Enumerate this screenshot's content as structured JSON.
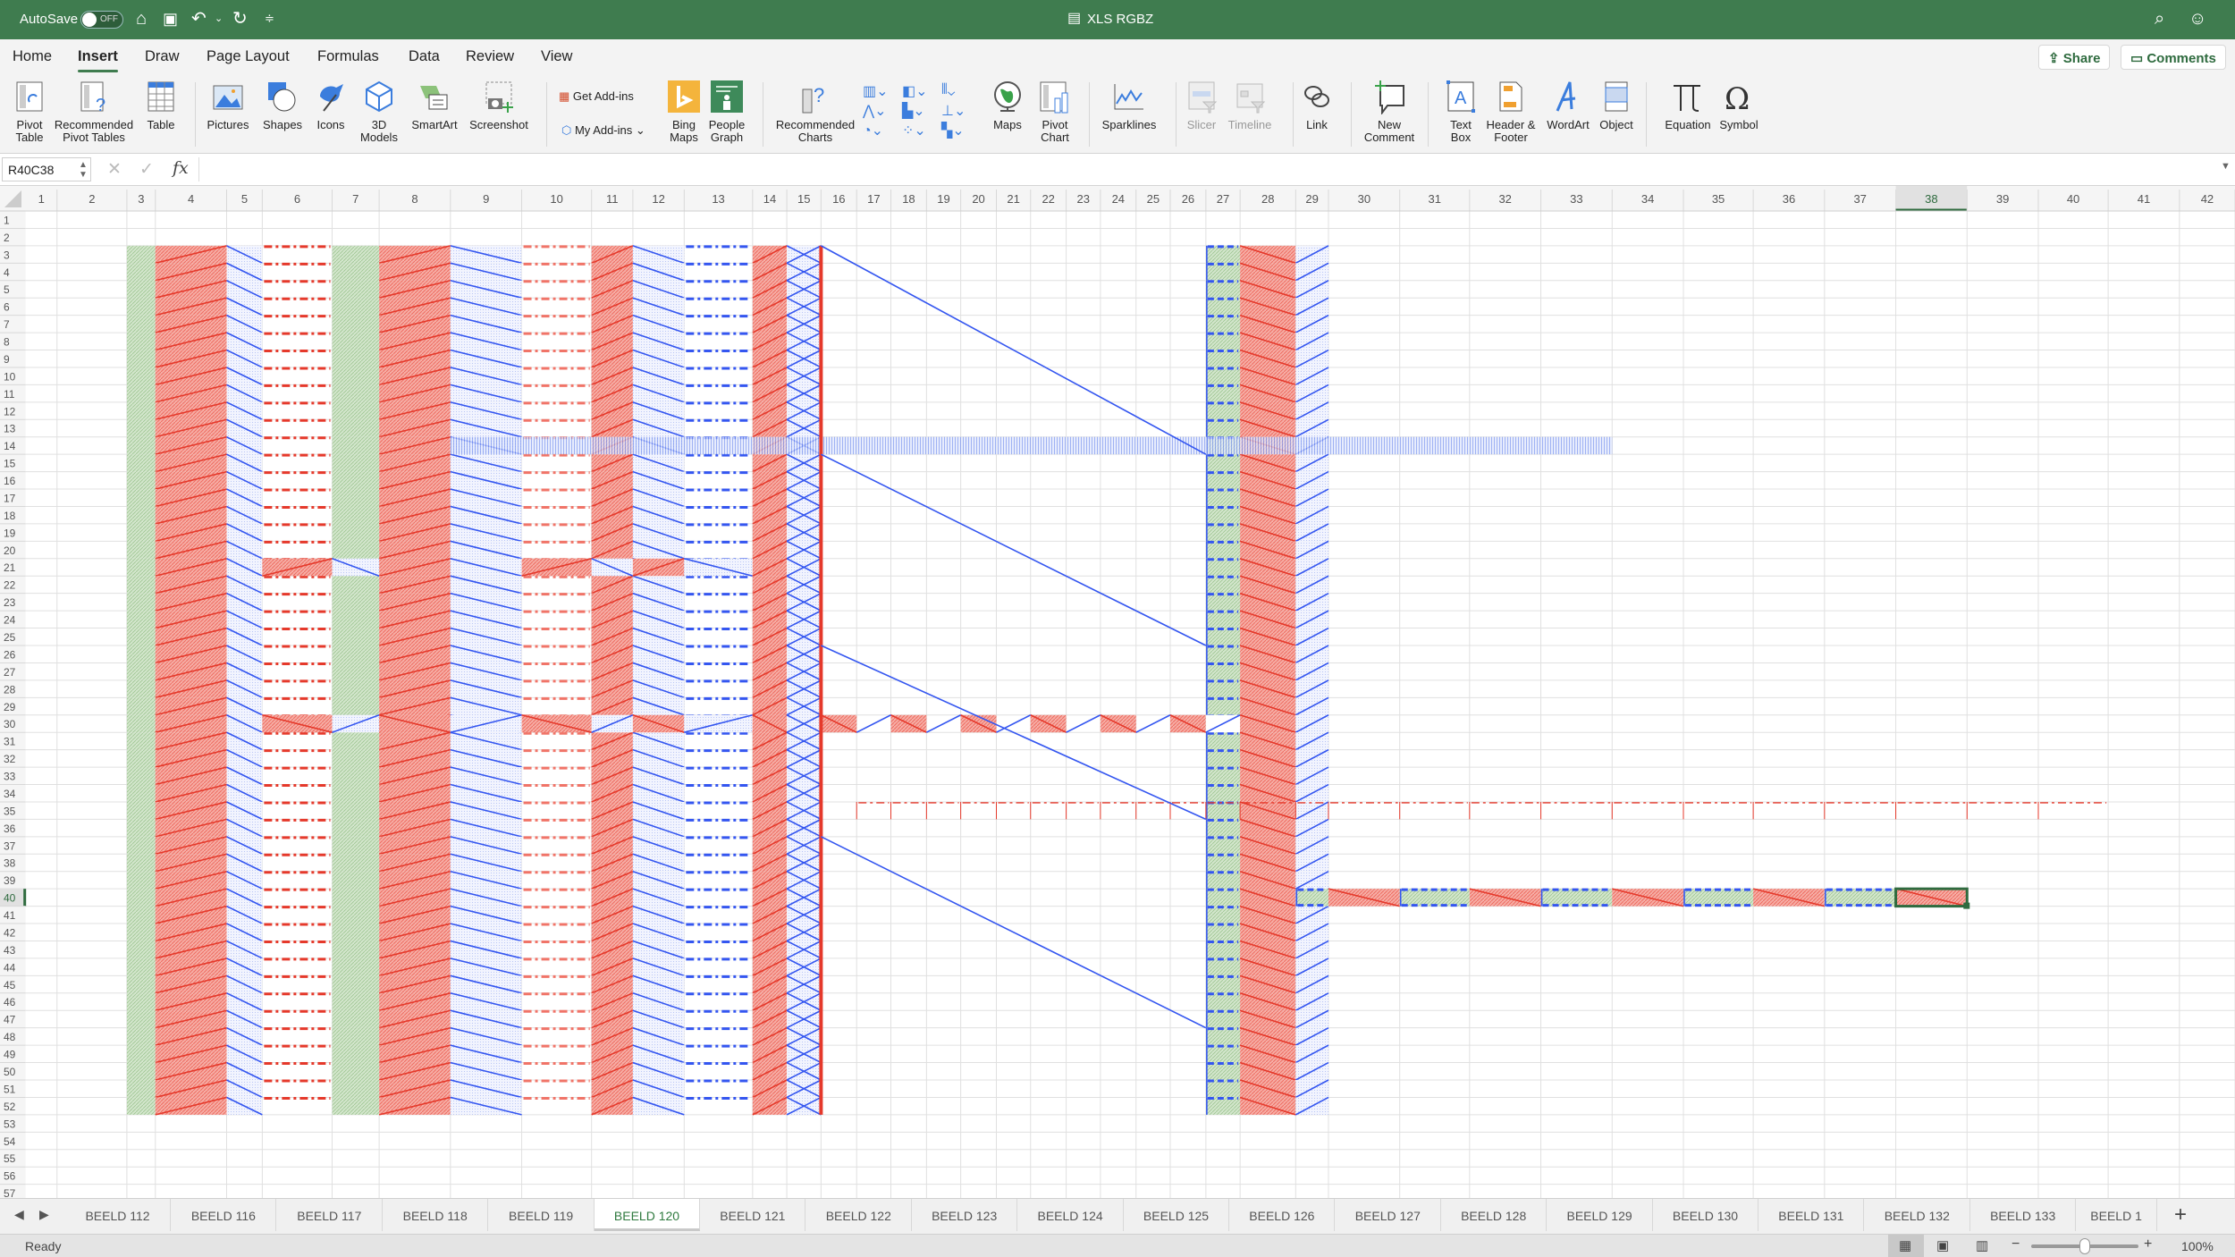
{
  "titlebar": {
    "autosave_label": "AutoSave",
    "autosave_state": "OFF",
    "doc_title": "XLS RGBZ",
    "accent": "#3f7c4f"
  },
  "menu_tabs": [
    {
      "label": "Home"
    },
    {
      "label": "Insert",
      "active": true
    },
    {
      "label": "Draw"
    },
    {
      "label": "Page Layout"
    },
    {
      "label": "Formulas"
    },
    {
      "label": "Data"
    },
    {
      "label": "Review"
    },
    {
      "label": "View"
    }
  ],
  "share_label": "Share",
  "comments_label": "Comments",
  "ribbon": {
    "items": [
      {
        "label": "Pivot\nTable",
        "icon": "pivot-table-icon"
      },
      {
        "label": "Recommended\nPivot Tables",
        "icon": "recommended-pivot-icon"
      },
      {
        "label": "Table",
        "icon": "table-icon"
      },
      {
        "label": "Pictures",
        "icon": "pictures-icon"
      },
      {
        "label": "Shapes",
        "icon": "shapes-icon"
      },
      {
        "label": "Icons",
        "icon": "icons-icon"
      },
      {
        "label": "3D\nModels",
        "icon": "3d-models-icon"
      },
      {
        "label": "SmartArt",
        "icon": "smartart-icon"
      },
      {
        "label": "Screenshot",
        "icon": "screenshot-icon"
      },
      {
        "label": "Bing\nMaps",
        "icon": "bing-maps-icon"
      },
      {
        "label": "People\nGraph",
        "icon": "people-graph-icon"
      },
      {
        "label": "Recommended\nCharts",
        "icon": "recommended-charts-icon"
      },
      {
        "label": "Maps",
        "icon": "maps-icon"
      },
      {
        "label": "Pivot\nChart",
        "icon": "pivot-chart-icon"
      },
      {
        "label": "Sparklines",
        "icon": "sparklines-icon"
      },
      {
        "label": "Slicer",
        "icon": "slicer-icon",
        "disabled": true
      },
      {
        "label": "Timeline",
        "icon": "timeline-icon",
        "disabled": true
      },
      {
        "label": "Link",
        "icon": "link-icon"
      },
      {
        "label": "New\nComment",
        "icon": "new-comment-icon"
      },
      {
        "label": "Text\nBox",
        "icon": "text-box-icon"
      },
      {
        "label": "Header &\nFooter",
        "icon": "header-footer-icon"
      },
      {
        "label": "WordArt",
        "icon": "wordart-icon"
      },
      {
        "label": "Object",
        "icon": "object-icon"
      },
      {
        "label": "Equation",
        "icon": "equation-icon"
      },
      {
        "label": "Symbol",
        "icon": "symbol-icon"
      }
    ],
    "get_addins": "Get Add-ins",
    "my_addins": "My Add-ins"
  },
  "formula_bar": {
    "name_box": "R40C38",
    "formula": ""
  },
  "sheet": {
    "column_count": 42,
    "row_count": 57,
    "selected": {
      "row": 40,
      "col": 38
    },
    "colors": {
      "green": "#cfe3c8",
      "red": "#f4a097",
      "blue": "#eef1fd",
      "red_line": "#e5392b",
      "blue_line": "#3456f0",
      "grid": "#e0e0e0"
    },
    "cells": [
      {
        "c": [
          3,
          3
        ],
        "r": [
          3,
          52
        ],
        "fill": "green"
      },
      {
        "c": [
          4,
          4
        ],
        "r": [
          3,
          52
        ],
        "fill": "red",
        "diag": "up"
      },
      {
        "c": [
          5,
          5
        ],
        "r": [
          3,
          52
        ],
        "fill": "blue",
        "diag": "down"
      },
      {
        "c": [
          6,
          6
        ],
        "r": [
          3,
          52
        ],
        "border": "dashdot-red"
      },
      {
        "c": [
          6,
          6
        ],
        "r": [
          21,
          21
        ],
        "fill": "red",
        "diag": "up"
      },
      {
        "c": [
          6,
          6
        ],
        "r": [
          30,
          30
        ],
        "fill": "red",
        "diag": "down"
      },
      {
        "c": [
          7,
          7
        ],
        "r": [
          3,
          52
        ],
        "fill": "green"
      },
      {
        "c": [
          7,
          7
        ],
        "r": [
          21,
          21
        ],
        "fill": "blue",
        "diag": "down"
      },
      {
        "c": [
          7,
          7
        ],
        "r": [
          30,
          30
        ],
        "fill": "blue",
        "diag": "up"
      },
      {
        "c": [
          8,
          8
        ],
        "r": [
          3,
          52
        ],
        "fill": "red",
        "diag": "up"
      },
      {
        "c": [
          8,
          8
        ],
        "r": [
          30,
          30
        ],
        "fill": "red",
        "diag": "down"
      },
      {
        "c": [
          9,
          9
        ],
        "r": [
          3,
          52
        ],
        "fill": "blue",
        "diag": "down"
      },
      {
        "c": [
          9,
          9
        ],
        "r": [
          30,
          30
        ],
        "fill": "blue",
        "diag": "up"
      },
      {
        "c": [
          10,
          10
        ],
        "r": [
          3,
          52
        ],
        "border": "dashdot-lightred"
      },
      {
        "c": [
          10,
          10
        ],
        "r": [
          21,
          21
        ],
        "fill": "red",
        "diag": "up"
      },
      {
        "c": [
          10,
          10
        ],
        "r": [
          30,
          30
        ],
        "fill": "red",
        "diag": "down"
      },
      {
        "c": [
          11,
          11
        ],
        "r": [
          3,
          52
        ],
        "fill": "red",
        "diag": "up"
      },
      {
        "c": [
          11,
          11
        ],
        "r": [
          21,
          21
        ],
        "fill": "blue",
        "diag": "down"
      },
      {
        "c": [
          11,
          11
        ],
        "r": [
          30,
          30
        ],
        "fill": "blue",
        "diag": "up"
      },
      {
        "c": [
          12,
          12
        ],
        "r": [
          3,
          52
        ],
        "fill": "blue",
        "diag": "down"
      },
      {
        "c": [
          12,
          12
        ],
        "r": [
          21,
          21
        ],
        "fill": "red",
        "diag": "up"
      },
      {
        "c": [
          12,
          12
        ],
        "r": [
          30,
          30
        ],
        "fill": "red",
        "diag": "down"
      },
      {
        "c": [
          13,
          13
        ],
        "r": [
          3,
          52
        ],
        "border": "dashdot-blue"
      },
      {
        "c": [
          13,
          13
        ],
        "r": [
          21,
          21
        ],
        "fill": "blue",
        "diag": "down"
      },
      {
        "c": [
          13,
          13
        ],
        "r": [
          30,
          30
        ],
        "fill": "blue",
        "diag": "up"
      },
      {
        "c": [
          14,
          14
        ],
        "r": [
          3,
          52
        ],
        "fill": "red",
        "diag": "up"
      },
      {
        "c": [
          14,
          14
        ],
        "r": [
          30,
          30
        ],
        "fill": "red",
        "diag": "down"
      },
      {
        "c": [
          15,
          15
        ],
        "r": [
          3,
          52
        ],
        "fill": "blue",
        "diag": "x"
      },
      {
        "c": [
          16,
          16
        ],
        "r": [
          30,
          30
        ],
        "fill": "red",
        "diag": "down"
      },
      {
        "c": [
          17,
          17
        ],
        "r": [
          30,
          30
        ],
        "diag": "up",
        "line": "blue"
      },
      {
        "c": [
          18,
          18
        ],
        "r": [
          30,
          30
        ],
        "fill": "red",
        "diag": "down"
      },
      {
        "c": [
          19,
          19
        ],
        "r": [
          30,
          30
        ],
        "diag": "up",
        "line": "blue"
      },
      {
        "c": [
          20,
          20
        ],
        "r": [
          30,
          30
        ],
        "fill": "red",
        "diag": "down"
      },
      {
        "c": [
          21,
          21
        ],
        "r": [
          30,
          30
        ],
        "diag": "up",
        "line": "blue"
      },
      {
        "c": [
          22,
          22
        ],
        "r": [
          30,
          30
        ],
        "fill": "red",
        "diag": "down"
      },
      {
        "c": [
          23,
          23
        ],
        "r": [
          30,
          30
        ],
        "diag": "up",
        "line": "blue"
      },
      {
        "c": [
          24,
          24
        ],
        "r": [
          30,
          30
        ],
        "fill": "red",
        "diag": "down"
      },
      {
        "c": [
          25,
          25
        ],
        "r": [
          30,
          30
        ],
        "diag": "up",
        "line": "blue"
      },
      {
        "c": [
          26,
          26
        ],
        "r": [
          30,
          30
        ],
        "fill": "red",
        "diag": "down"
      },
      {
        "c": [
          27,
          27
        ],
        "r": [
          3,
          52
        ],
        "fill": "green",
        "border": "dashbox-blue"
      },
      {
        "c": [
          27,
          27
        ],
        "r": [
          30,
          30
        ],
        "fill": "white",
        "diag": "up",
        "line": "blue"
      },
      {
        "c": [
          28,
          28
        ],
        "r": [
          3,
          52
        ],
        "fill": "red",
        "diag": "down"
      },
      {
        "c": [
          29,
          29
        ],
        "r": [
          3,
          52
        ],
        "fill": "blue",
        "diag": "up"
      },
      {
        "c": [
          9,
          33
        ],
        "r": [
          14,
          14
        ],
        "fill": "stripe"
      },
      {
        "c": [
          17,
          40
        ],
        "r": [
          35,
          35
        ],
        "border": "dashdot-ticks-red"
      },
      {
        "c": [
          29,
          29
        ],
        "r": [
          40,
          40
        ],
        "fill": "green",
        "border": "dashbox-blue"
      },
      {
        "c": [
          30,
          30
        ],
        "r": [
          40,
          40
        ],
        "fill": "red",
        "diag": "down"
      },
      {
        "c": [
          31,
          31
        ],
        "r": [
          40,
          40
        ],
        "fill": "green",
        "border": "dashbox-blue"
      },
      {
        "c": [
          32,
          32
        ],
        "r": [
          40,
          40
        ],
        "fill": "red",
        "diag": "down"
      },
      {
        "c": [
          33,
          33
        ],
        "r": [
          40,
          40
        ],
        "fill": "green",
        "border": "dashbox-blue"
      },
      {
        "c": [
          34,
          34
        ],
        "r": [
          40,
          40
        ],
        "fill": "red",
        "diag": "down"
      },
      {
        "c": [
          35,
          35
        ],
        "r": [
          40,
          40
        ],
        "fill": "green",
        "border": "dashbox-blue"
      },
      {
        "c": [
          36,
          36
        ],
        "r": [
          40,
          40
        ],
        "fill": "red",
        "diag": "down"
      },
      {
        "c": [
          37,
          37
        ],
        "r": [
          40,
          40
        ],
        "fill": "green",
        "border": "dashbox-blue"
      },
      {
        "c": [
          38,
          38
        ],
        "r": [
          40,
          40
        ],
        "fill": "red",
        "diag": "down"
      }
    ],
    "red_vline": {
      "after_col": 15,
      "r": [
        3,
        52
      ]
    },
    "lines": [
      {
        "from": {
          "c": 16,
          "r": 3
        },
        "to": {
          "c": 27,
          "r": 15
        }
      },
      {
        "from": {
          "c": 16,
          "r": 15
        },
        "to": {
          "c": 27,
          "r": 26
        }
      },
      {
        "from": {
          "c": 16,
          "r": 26
        },
        "to": {
          "c": 27,
          "r": 36
        }
      },
      {
        "from": {
          "c": 16,
          "r": 37
        },
        "to": {
          "c": 27,
          "r": 48
        }
      }
    ]
  },
  "sheet_tabs": [
    {
      "label": "BEELD 112"
    },
    {
      "label": "BEELD 116"
    },
    {
      "label": "BEELD 117"
    },
    {
      "label": "BEELD 118"
    },
    {
      "label": "BEELD 119"
    },
    {
      "label": "BEELD 120",
      "active": true
    },
    {
      "label": "BEELD 121"
    },
    {
      "label": "BEELD 122"
    },
    {
      "label": "BEELD 123"
    },
    {
      "label": "BEELD 124"
    },
    {
      "label": "BEELD 125"
    },
    {
      "label": "BEELD 126"
    },
    {
      "label": "BEELD 127"
    },
    {
      "label": "BEELD 128"
    },
    {
      "label": "BEELD 129"
    },
    {
      "label": "BEELD 130"
    },
    {
      "label": "BEELD 131"
    },
    {
      "label": "BEELD 132"
    },
    {
      "label": "BEELD 133"
    },
    {
      "label": "BEELD 1"
    }
  ],
  "status": {
    "text": "Ready",
    "zoom": "100%",
    "zoom_percent": 100
  }
}
